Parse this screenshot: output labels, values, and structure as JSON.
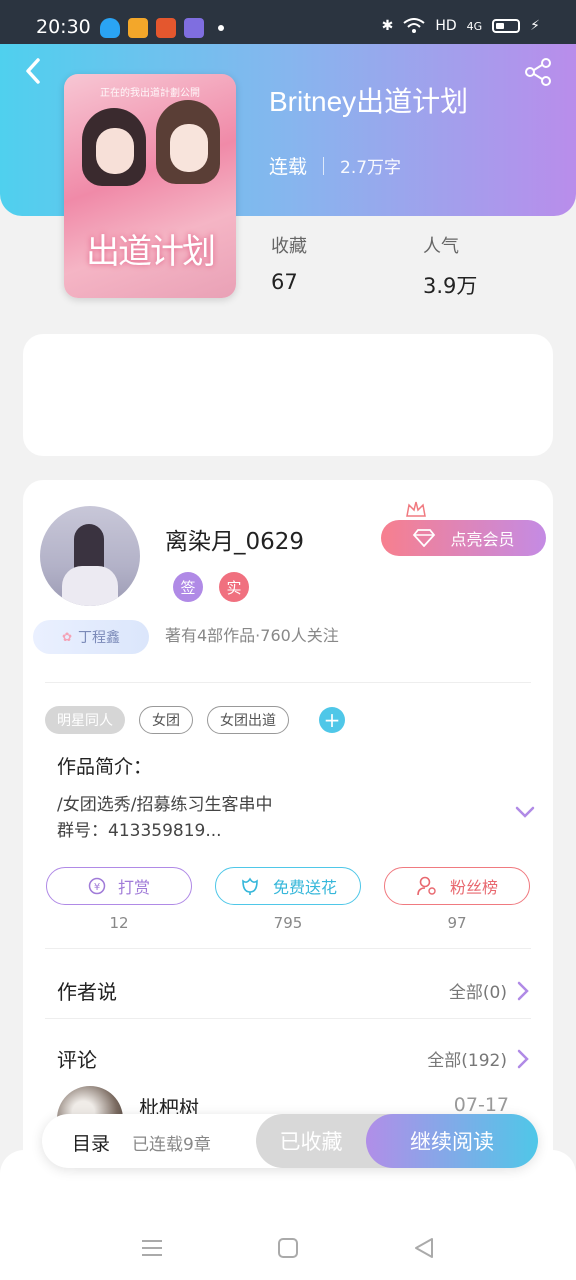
{
  "status_bar": {
    "time": "20:30",
    "network": "HD",
    "signal": "4G"
  },
  "book": {
    "title": "Britney出道计划",
    "status": "连载",
    "words": "2.7万字",
    "cover_title": "出道计划",
    "cover_note": "正在的我出道計劃公開"
  },
  "stats": {
    "favorites_label": "收藏",
    "favorites_value": "67",
    "popularity_label": "人气",
    "popularity_value": "3.9万"
  },
  "author": {
    "name": "离染月_0629",
    "badge_sign": "签",
    "badge_real": "实",
    "meta": "著有4部作品·760人关注",
    "vip_tag": "丁程鑫",
    "member_button": "点亮会员"
  },
  "tags": [
    "明星同人",
    "女团",
    "女团出道"
  ],
  "intro": {
    "title": "作品简介：",
    "line1": "/女团选秀/招募练习生客串中",
    "line2": "群号：413359819..."
  },
  "actions": [
    {
      "label": "打赏",
      "count": "12"
    },
    {
      "label": "免费送花",
      "count": "795"
    },
    {
      "label": "粉丝榜",
      "count": "97"
    }
  ],
  "author_says": {
    "title": "作者说",
    "link": "全部(0)"
  },
  "comments": {
    "title": "评论",
    "link": "全部(192)",
    "first_user": "枇杷树",
    "first_date": "07-17"
  },
  "bottom_bar": {
    "toc": "目录",
    "chapters": "已连载9章",
    "favorited": "已收藏",
    "continue": "继续阅读"
  },
  "colors": {
    "accent_cyan": "#4fc7e8",
    "accent_purple": "#b08ae6",
    "accent_red": "#f07a80"
  }
}
